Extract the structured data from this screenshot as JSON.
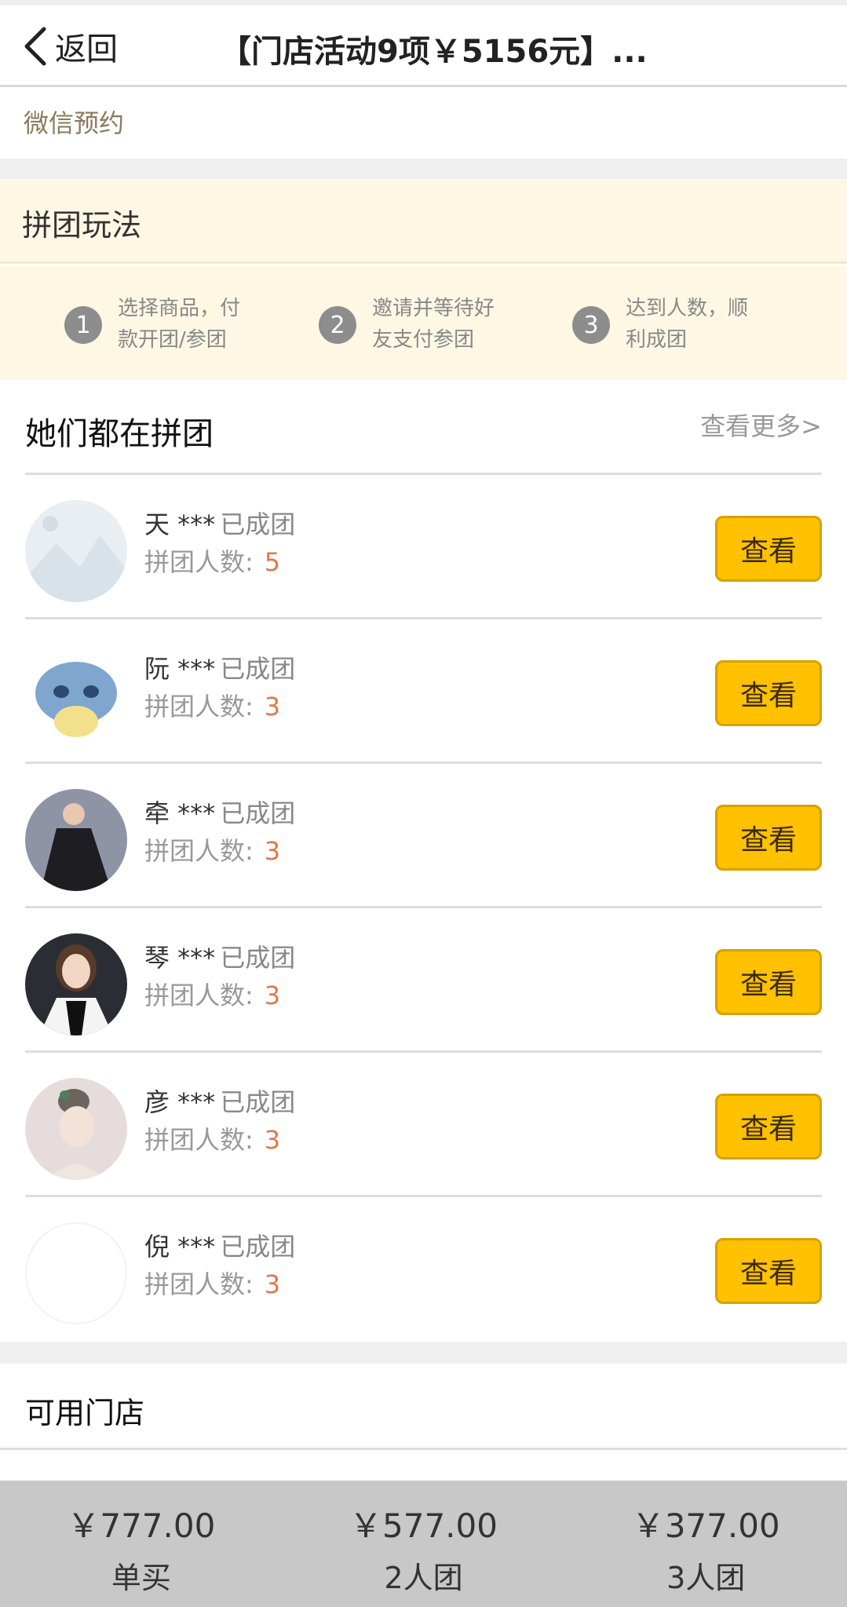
{
  "header": {
    "back_label": "返回",
    "title": "【门店活动9项￥5156元】..."
  },
  "wechat_label": "微信预约",
  "rules": {
    "title": "拼团玩法",
    "steps": [
      {
        "num": "1",
        "text": "选择商品，付款开团/参团"
      },
      {
        "num": "2",
        "text": "邀请并等待好友支付参团"
      },
      {
        "num": "3",
        "text": "达到人数，顺利成团"
      }
    ]
  },
  "groups": {
    "title": "她们都在拼团",
    "more": "查看更多>",
    "count_label": "拼团人数:",
    "status": "已成团",
    "view_label": "查看",
    "items": [
      {
        "name": "天 ***",
        "count": "5",
        "avatar": "placeholder-avatar"
      },
      {
        "name": "阮 ***",
        "count": "3",
        "avatar": "cartoon-avatar"
      },
      {
        "name": "牵 ***",
        "count": "3",
        "avatar": "photo-avatar"
      },
      {
        "name": "琴 ***",
        "count": "3",
        "avatar": "photo-avatar"
      },
      {
        "name": "彦 ***",
        "count": "3",
        "avatar": "illustration-avatar"
      },
      {
        "name": "倪 ***",
        "count": "3",
        "avatar": "blank-avatar"
      }
    ]
  },
  "stores_label": "可用门店",
  "options": [
    {
      "price": "￥777.00",
      "label": "单买"
    },
    {
      "price": "￥577.00",
      "label": "2人团"
    },
    {
      "price": "￥377.00",
      "label": "3人团"
    }
  ]
}
